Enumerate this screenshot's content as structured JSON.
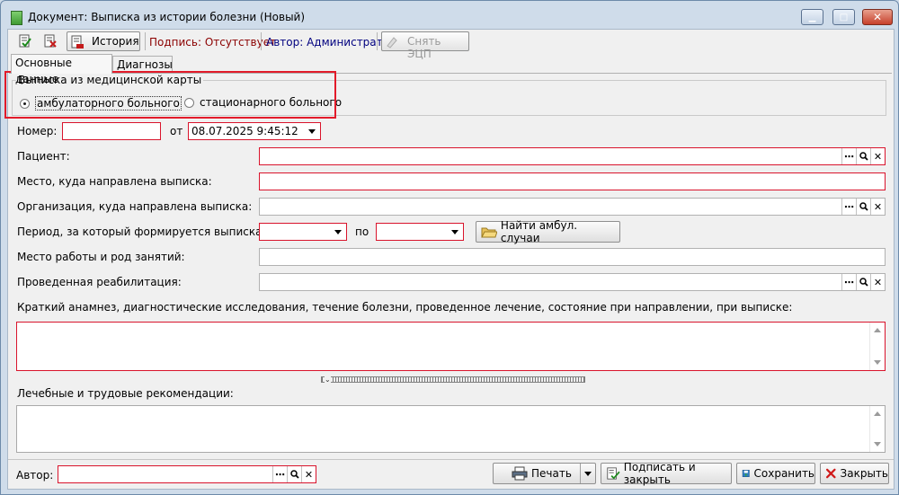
{
  "window": {
    "title": "Документ: Выписка из истории болезни (Новый)"
  },
  "toolbar": {
    "history_label": "История",
    "signature_label": "Подпись: Отсутствует",
    "author_label": "Автор: Администратор",
    "remove_signature_label": "Снять ЭЦП"
  },
  "tabs": [
    {
      "label": "Основные данные"
    },
    {
      "label": "Диагнозы"
    }
  ],
  "extract_group": {
    "legend": "Выписка из медицинской карты",
    "option_outpatient": "амбулаторного больного",
    "option_inpatient": "стационарного больного",
    "selected": "outpatient"
  },
  "form": {
    "number_label": "Номер:",
    "number_value": "",
    "from_label": "от",
    "date_value": "08.07.2025 9:45:12",
    "patient_label": "Пациент:",
    "place_label": "Место, куда направлена выписка:",
    "organization_label": "Организация, куда направлена выписка:",
    "period_label": "Период, за который формируется выписка: с",
    "period_to_label": "по",
    "find_cases_label": "Найти амбул. случаи",
    "workplace_label": "Место работы и род занятий:",
    "rehab_label": "Проведенная реабилитация:",
    "anamnesis_label": "Краткий анамнез, диагностические исследования, течение болезни, проведенное лечение, состояние при направлении, при выписке:",
    "recommendations_label": "Лечебные и трудовые рекомендации:"
  },
  "footer": {
    "author_label": "Автор:",
    "print_label": "Печать",
    "sign_close_label": "Подписать и закрыть",
    "save_label": "Сохранить",
    "close_label": "Закрыть"
  },
  "colors": {
    "required_border": "#d9142c",
    "highlight": "#e21b2a",
    "signature_text": "#8b0000",
    "author_text": "#00007f"
  }
}
